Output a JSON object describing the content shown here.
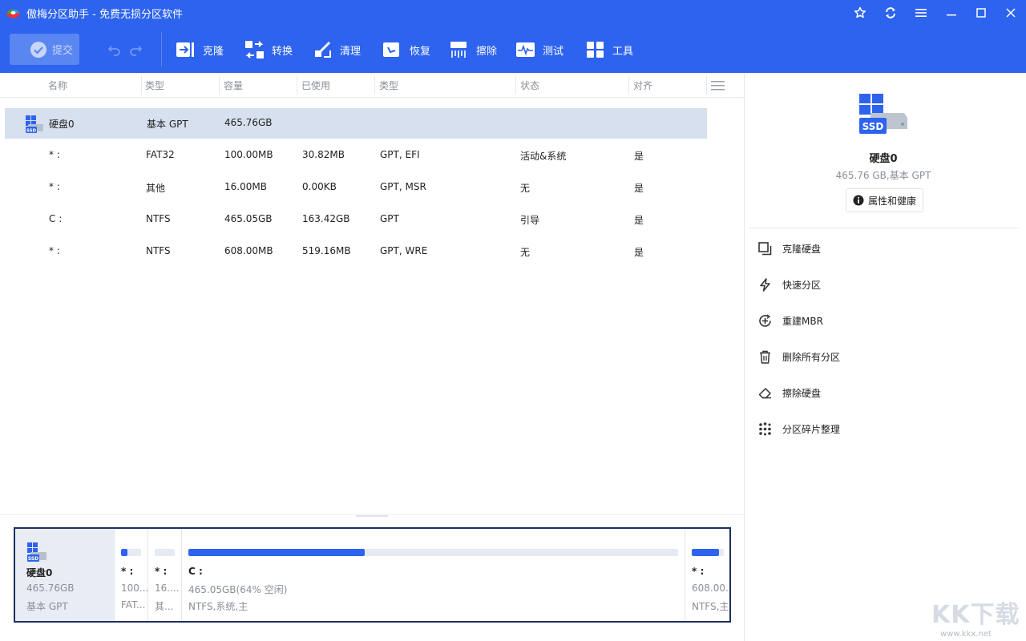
{
  "window": {
    "title": "傲梅分区助手 - 免费无损分区软件"
  },
  "toolbar": {
    "submit_label": "提交",
    "items": [
      {
        "label": "克隆",
        "icon": "clone-icon"
      },
      {
        "label": "转换",
        "icon": "convert-icon"
      },
      {
        "label": "清理",
        "icon": "clean-icon"
      },
      {
        "label": "恢复",
        "icon": "recover-icon"
      },
      {
        "label": "擦除",
        "icon": "wipe-icon"
      },
      {
        "label": "测试",
        "icon": "test-icon"
      },
      {
        "label": "工具",
        "icon": "tools-icon"
      }
    ]
  },
  "columns": [
    "名称",
    "类型",
    "容量",
    "已使用",
    "类型",
    "状态",
    "对齐"
  ],
  "disk_row": {
    "name": "硬盘0",
    "type": "基本 GPT",
    "capacity": "465.76GB"
  },
  "partitions": [
    {
      "name": "* :",
      "fs": "FAT32",
      "capacity": "100.00MB",
      "used": "30.82MB",
      "ptype": "GPT, EFI",
      "status": "活动&系统",
      "align": "是"
    },
    {
      "name": "* :",
      "fs": "其他",
      "capacity": "16.00MB",
      "used": "0.00KB",
      "ptype": "GPT, MSR",
      "status": "无",
      "align": "是"
    },
    {
      "name": "C :",
      "fs": "NTFS",
      "capacity": "465.05GB",
      "used": "163.42GB",
      "ptype": "GPT",
      "status": "引导",
      "align": "是"
    },
    {
      "name": "* :",
      "fs": "NTFS",
      "capacity": "608.00MB",
      "used": "519.16MB",
      "ptype": "GPT, WRE",
      "status": "无",
      "align": "是"
    }
  ],
  "diskmap": {
    "disk": {
      "name": "硬盘0",
      "size": "465.76GB",
      "type": "基本 GPT",
      "badge": "SSD"
    },
    "parts": [
      {
        "name": "* :",
        "line2": "100...",
        "line3": "FAT...",
        "used_fraction": 0.31
      },
      {
        "name": "* :",
        "line2": "16....",
        "line3": "其...",
        "used_fraction": 0.0
      },
      {
        "name": "C :",
        "line2": "465.05GB(64% 空闲)",
        "line3": "NTFS,系统,主",
        "used_fraction": 0.36
      },
      {
        "name": "* :",
        "line2": "608.00...",
        "line3": "NTFS,主",
        "used_fraction": 0.85
      }
    ]
  },
  "right_panel": {
    "disk_name": "硬盘0",
    "disk_sub": "465.76 GB,基本 GPT",
    "badge": "SSD",
    "properties_label": "属性和健康",
    "operations": [
      {
        "label": "克隆硬盘",
        "icon": "clone-disk-icon"
      },
      {
        "label": "快速分区",
        "icon": "quick-partition-icon"
      },
      {
        "label": "重建MBR",
        "icon": "rebuild-mbr-icon"
      },
      {
        "label": "删除所有分区",
        "icon": "delete-all-icon"
      },
      {
        "label": "擦除硬盘",
        "icon": "eraser-icon"
      },
      {
        "label": "分区碎片整理",
        "icon": "defrag-icon"
      }
    ]
  },
  "watermark": {
    "text": "KK下载",
    "url": "www.kkx.net"
  },
  "colors": {
    "accent": "#2d63ee",
    "selected_row": "#d6e0ee",
    "diskmap_border": "#1d2f63"
  }
}
